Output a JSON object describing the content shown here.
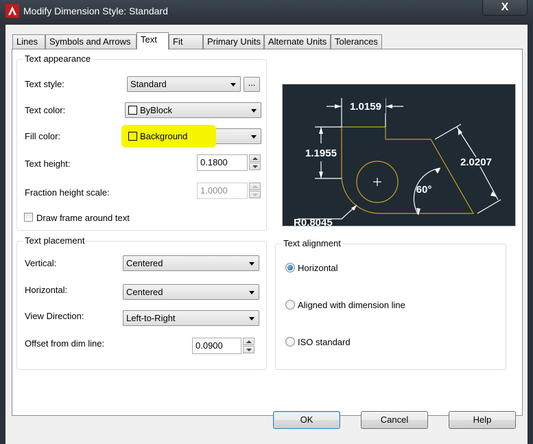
{
  "window": {
    "title": "Modify Dimension Style: Standard",
    "close_glyph": "X"
  },
  "tabs": [
    {
      "label": "Lines"
    },
    {
      "label": "Symbols and Arrows"
    },
    {
      "label": "Text",
      "active": true
    },
    {
      "label": "Fit"
    },
    {
      "label": "Primary Units"
    },
    {
      "label": "Alternate Units"
    },
    {
      "label": "Tolerances"
    }
  ],
  "text_appearance": {
    "title": "Text appearance",
    "text_style_label": "Text style:",
    "text_style_value": "Standard",
    "browse_label": "...",
    "text_color_label": "Text color:",
    "text_color_value": "ByBlock",
    "fill_color_label": "Fill color:",
    "fill_color_value": "Background",
    "text_height_label": "Text height:",
    "text_height_value": "0.1800",
    "fraction_label": "Fraction height scale:",
    "fraction_value": "1.0000",
    "frame_label": "Draw frame around text"
  },
  "text_placement": {
    "title": "Text placement",
    "vertical_label": "Vertical:",
    "vertical_value": "Centered",
    "horizontal_label": "Horizontal:",
    "horizontal_value": "Centered",
    "view_label": "View Direction:",
    "view_value": "Left-to-Right",
    "offset_label": "Offset from dim line:",
    "offset_value": "0.0900"
  },
  "text_alignment": {
    "title": "Text alignment",
    "options": [
      "Horizontal",
      "Aligned with dimension line",
      "ISO standard"
    ],
    "selected": "Horizontal"
  },
  "preview": {
    "dim_top": "1.0159",
    "dim_left": "1.1955",
    "dim_right": "2.0207",
    "angle": "60°",
    "radius": "R0.8045",
    "line_color": "#c8a21c"
  },
  "buttons": {
    "ok": "OK",
    "cancel": "Cancel",
    "help": "Help"
  },
  "colors": {
    "highlight": "#f6f600",
    "preview_bg": "#1f2a33"
  }
}
